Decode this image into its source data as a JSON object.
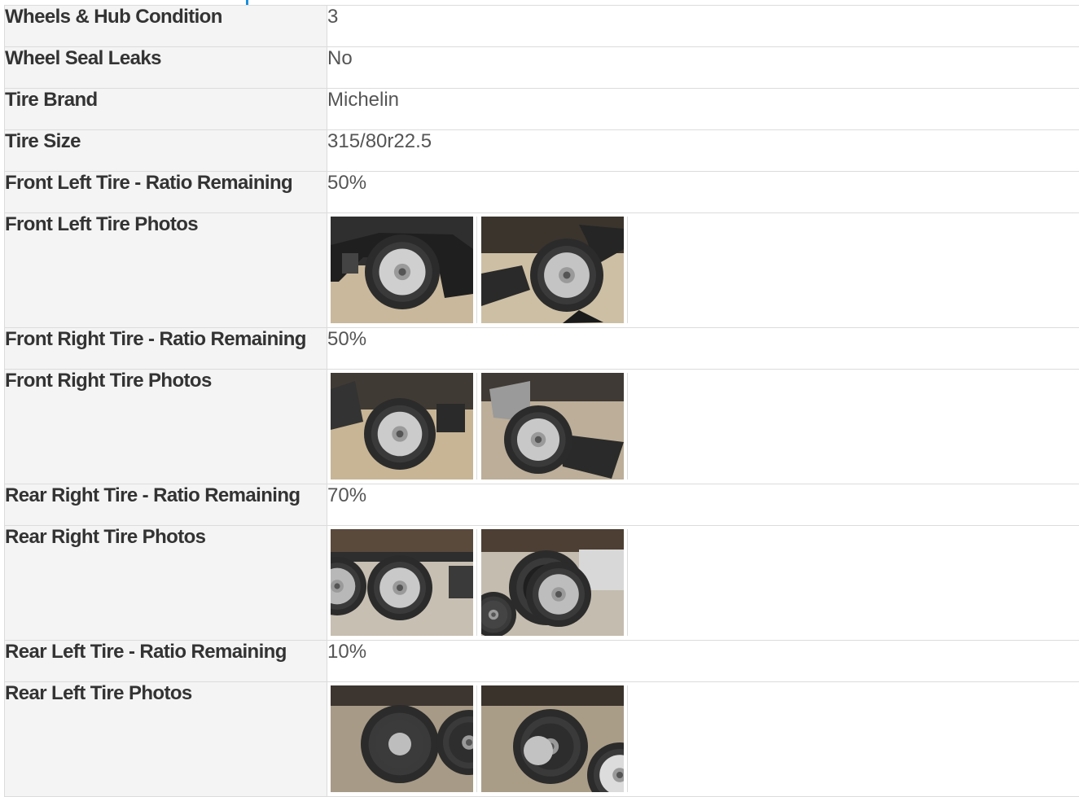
{
  "rows": [
    {
      "type": "text",
      "label": "Wheels & Hub Condition",
      "value": "3"
    },
    {
      "type": "text",
      "label": "Wheel Seal Leaks",
      "value": "No"
    },
    {
      "type": "text",
      "label": "Tire Brand",
      "value": "Michelin"
    },
    {
      "type": "text",
      "label": "Tire Size",
      "value": "315/80r22.5"
    },
    {
      "type": "text",
      "label": "Front Left Tire - Ratio Remaining",
      "value": "50%"
    },
    {
      "type": "photos",
      "label": "Front Left Tire Photos",
      "photos": [
        "front-left-tire-photo-1",
        "front-left-tire-photo-2"
      ]
    },
    {
      "type": "text",
      "label": "Front Right Tire - Ratio Remaining",
      "value": "50%"
    },
    {
      "type": "photos",
      "label": "Front Right Tire Photos",
      "photos": [
        "front-right-tire-photo-1",
        "front-right-tire-photo-2"
      ]
    },
    {
      "type": "text",
      "label": "Rear Right Tire - Ratio Remaining",
      "value": "70%"
    },
    {
      "type": "photos",
      "label": "Rear Right Tire Photos",
      "photos": [
        "rear-right-tire-photo-1",
        "rear-right-tire-photo-2"
      ]
    },
    {
      "type": "text",
      "label": "Rear Left Tire - Ratio Remaining",
      "value": "10%"
    },
    {
      "type": "photos",
      "label": "Rear Left Tire Photos",
      "photos": [
        "rear-left-tire-photo-1",
        "rear-left-tire-photo-2"
      ]
    }
  ],
  "colors": {
    "accent": "#1a8fdc",
    "label_bg": "#f4f4f4",
    "border": "#dcdcdc"
  }
}
